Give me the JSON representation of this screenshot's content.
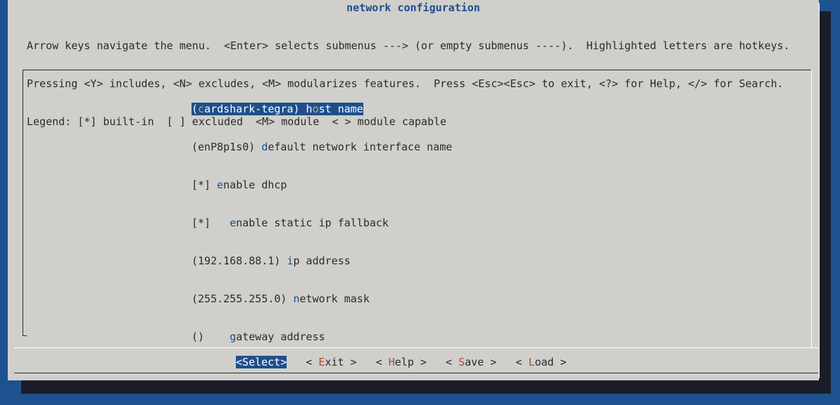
{
  "window": {
    "title": "network configuration"
  },
  "help": {
    "line1": "Arrow keys navigate the menu.  <Enter> selects submenus ---> (or empty submenus ----).  Highlighted letters are hotkeys.",
    "line2": "Pressing <Y> includes, <N> excludes, <M> modularizes features.  Press <Esc><Esc> to exit, <?> for Help, </> for Search.",
    "line3": "Legend: [*] built-in  [ ] excluded  <M> module  < > module capable"
  },
  "menu": {
    "items": [
      {
        "prefix": "(",
        "hotkey": "c",
        "rest": "ardshark-tegra) h",
        "hotkey2": "o",
        "rest2": "st name",
        "selected": true
      },
      {
        "prefix": "(enP8p1s0) ",
        "hotkey": "d",
        "rest": "efault network interface name"
      },
      {
        "prefix": "[*] ",
        "hotkey": "e",
        "rest": "nable dhcp"
      },
      {
        "prefix": "[*]   ",
        "hotkey": "e",
        "rest": "nable static ip fallback"
      },
      {
        "prefix": "(192.168.88.1) ",
        "hotkey": "i",
        "rest": "p address"
      },
      {
        "prefix": "(255.255.255.0) ",
        "hotkey": "n",
        "rest": "etwork mask"
      },
      {
        "prefix": "()    ",
        "hotkey": "g",
        "rest": "ateway address"
      }
    ]
  },
  "buttons": {
    "select": {
      "open": "<",
      "hotkey": "S",
      "rest": "elect",
      "close": ">"
    },
    "exit": {
      "open": "< ",
      "hotkey": "E",
      "rest": "xit",
      "close": " >"
    },
    "help": {
      "open": "< ",
      "hotkey": "H",
      "rest": "elp",
      "close": " >"
    },
    "save": {
      "open": "< ",
      "hotkey": "S",
      "rest": "ave",
      "close": " >"
    },
    "load": {
      "open": "< ",
      "hotkey": "L",
      "rest": "oad",
      "close": " >"
    }
  },
  "colors": {
    "background": "#1d5190",
    "dialog": "#d0cfcc",
    "accent": "#1e4f8c",
    "hotkey_button": "#b24a32",
    "hotkey_selected": "#e0a24a"
  }
}
